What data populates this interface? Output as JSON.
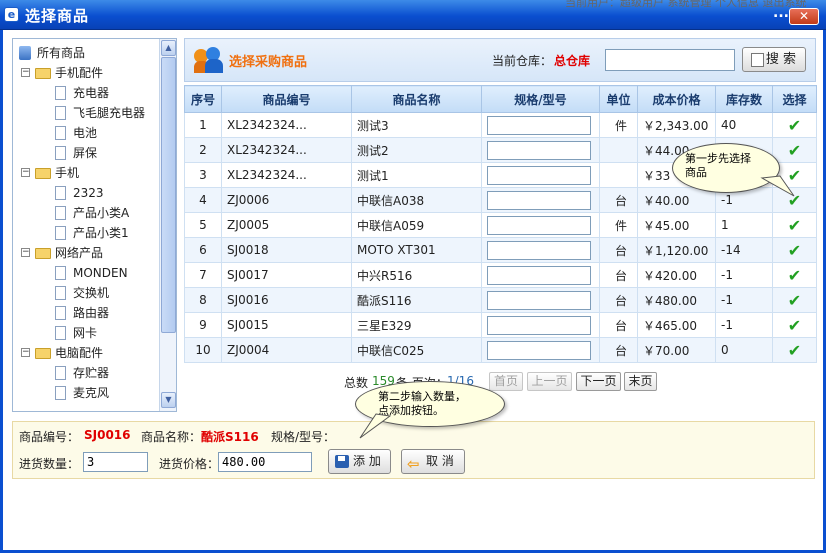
{
  "window": {
    "title": "选择商品",
    "bg_text": "当前用户：超级用户 系统管理 个人信息 退出系统",
    "dots": "...",
    "close_label": "✕",
    "app_icon": "e"
  },
  "tree": {
    "root_label": "所有商品",
    "items": [
      {
        "label": "手机配件",
        "level": 1,
        "icon": "folder-icon",
        "expander": "minus"
      },
      {
        "label": "充电器",
        "level": 2,
        "icon": "document-icon"
      },
      {
        "label": "飞毛腿充电器",
        "level": 2,
        "icon": "document-icon"
      },
      {
        "label": "电池",
        "level": 2,
        "icon": "document-icon"
      },
      {
        "label": "屏保",
        "level": 2,
        "icon": "document-icon"
      },
      {
        "label": "手机",
        "level": 1,
        "icon": "folder-icon",
        "expander": "minus"
      },
      {
        "label": "2323",
        "level": 2,
        "icon": "document-icon"
      },
      {
        "label": "产品小类A",
        "level": 2,
        "icon": "document-icon"
      },
      {
        "label": "产品小类1",
        "level": 2,
        "icon": "document-icon"
      },
      {
        "label": "网络产品",
        "level": 1,
        "icon": "folder-icon",
        "expander": "minus"
      },
      {
        "label": "MONDEN",
        "level": 2,
        "icon": "document-icon"
      },
      {
        "label": "交换机",
        "level": 2,
        "icon": "document-icon"
      },
      {
        "label": "路由器",
        "level": 2,
        "icon": "document-icon"
      },
      {
        "label": "网卡",
        "level": 2,
        "icon": "document-icon"
      },
      {
        "label": "电脑配件",
        "level": 1,
        "icon": "folder-icon",
        "expander": "minus"
      },
      {
        "label": "存贮器",
        "level": 2,
        "icon": "document-icon"
      },
      {
        "label": "麦克风",
        "level": 2,
        "icon": "document-icon"
      }
    ]
  },
  "header": {
    "section_title": "选择采购商品",
    "warehouse_label": "当前仓库：",
    "warehouse_value": "总仓库",
    "search_value": "",
    "search_button": "搜 索"
  },
  "table": {
    "columns": [
      "序号",
      "商品编号",
      "商品名称",
      "规格/型号",
      "单位",
      "成本价格",
      "库存数",
      "选择"
    ],
    "rows": [
      {
        "no": "1",
        "code": "XL2342324...",
        "name": "测试3",
        "unit": "件",
        "price": "￥2,343.00",
        "stock": "40"
      },
      {
        "no": "2",
        "code": "XL2342324...",
        "name": "测试2",
        "unit": "",
        "price": "￥44.00",
        "stock": ""
      },
      {
        "no": "3",
        "code": "XL2342324...",
        "name": "测试1",
        "unit": "",
        "price": "￥33",
        "stock": ""
      },
      {
        "no": "4",
        "code": "ZJ0006",
        "name": "中联信A038",
        "unit": "台",
        "price": "￥40.00",
        "stock": "-1"
      },
      {
        "no": "5",
        "code": "ZJ0005",
        "name": "中联信A059",
        "unit": "件",
        "price": "￥45.00",
        "stock": "1"
      },
      {
        "no": "6",
        "code": "SJ0018",
        "name": "MOTO XT301",
        "unit": "台",
        "price": "￥1,120.00",
        "stock": "-14"
      },
      {
        "no": "7",
        "code": "SJ0017",
        "name": "中兴R516",
        "unit": "台",
        "price": "￥420.00",
        "stock": "-1"
      },
      {
        "no": "8",
        "code": "SJ0016",
        "name": "酷派S116",
        "unit": "台",
        "price": "￥480.00",
        "stock": "-1"
      },
      {
        "no": "9",
        "code": "SJ0015",
        "name": "三星E329",
        "unit": "台",
        "price": "￥465.00",
        "stock": "-1"
      },
      {
        "no": "10",
        "code": "ZJ0004",
        "name": "中联信C025",
        "unit": "台",
        "price": "￥70.00",
        "stock": "0"
      }
    ],
    "select_glyph": "✔"
  },
  "pager": {
    "total_label": "总数",
    "total_value": "159",
    "mid_text": "条 页次：",
    "page_value": "1/16",
    "first": "首页",
    "prev": "上一页",
    "next": "下一页",
    "last": "末页"
  },
  "bottom": {
    "code_label": "商品编号：",
    "code_value": "SJ0016",
    "name_label": "商品名称：",
    "name_value": "酷派S116",
    "spec_label": "规格/型号：",
    "qty_label": "进货数量：",
    "qty_value": "3",
    "price_label": "进货价格：",
    "price_value": "480.00",
    "add_button": "添 加",
    "cancel_button": "取 消"
  },
  "callouts": {
    "step1": "第一步先选择\n商品",
    "step2": "第二步输入数量，\n点添加按钮。"
  },
  "colors": {
    "titlebar": "#0a4fd0",
    "accent_orange": "#f07010",
    "highlight_red": "#e00000",
    "check_green": "#22a022"
  }
}
